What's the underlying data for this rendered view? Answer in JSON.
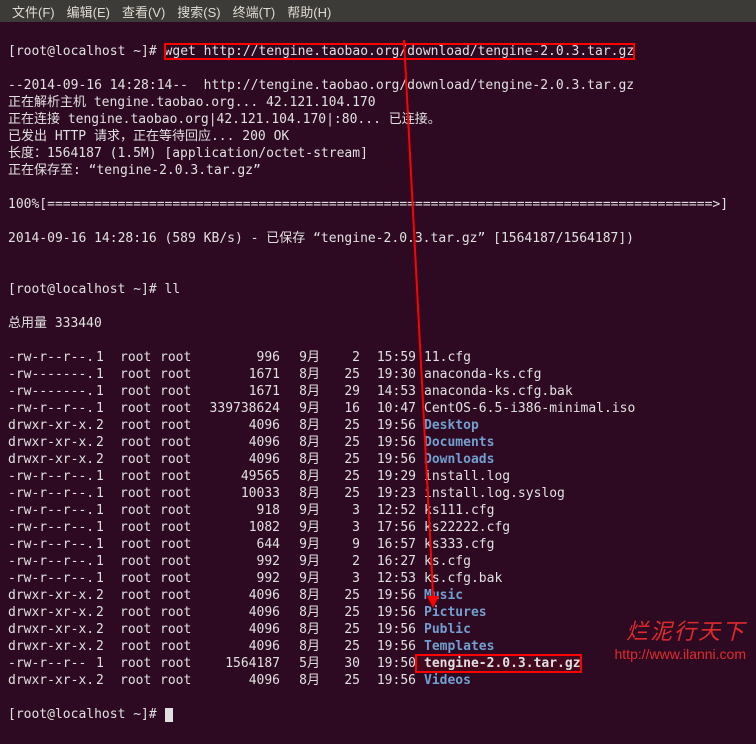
{
  "menubar": [
    "文件(F)",
    "编辑(E)",
    "查看(V)",
    "搜索(S)",
    "终端(T)",
    "帮助(H)"
  ],
  "prompt": "[root@localhost ~]#",
  "cmd_wget": "wget http://tengine.taobao.org/download/tengine-2.0.3.tar.gz",
  "wget_output": [
    "--2014-09-16 14:28:14--  http://tengine.taobao.org/download/tengine-2.0.3.tar.gz",
    "正在解析主机 tengine.taobao.org... 42.121.104.170",
    "正在连接 tengine.taobao.org|42.121.104.170|:80... 已连接。",
    "已发出 HTTP 请求，正在等待回应... 200 OK",
    "长度：1564187 (1.5M) [application/octet-stream]",
    "正在保存至: “tengine-2.0.3.tar.gz”",
    "",
    "100%[=====================================================================================>]",
    "",
    "2014-09-16 14:28:16 (589 KB/s) - 已保存 “tengine-2.0.3.tar.gz” [1564187/1564187])",
    ""
  ],
  "cmd_ll": "ll",
  "ll_total": "总用量 333440",
  "files": [
    {
      "perm": "-rw-r--r--.",
      "ln": "1",
      "own": "root",
      "grp": "root",
      "size": "996",
      "mon": "9月",
      "day": "2",
      "time": "15:59",
      "name": "11.cfg",
      "dir": false
    },
    {
      "perm": "-rw-------.",
      "ln": "1",
      "own": "root",
      "grp": "root",
      "size": "1671",
      "mon": "8月",
      "day": "25",
      "time": "19:30",
      "name": "anaconda-ks.cfg",
      "dir": false
    },
    {
      "perm": "-rw-------.",
      "ln": "1",
      "own": "root",
      "grp": "root",
      "size": "1671",
      "mon": "8月",
      "day": "29",
      "time": "14:53",
      "name": "anaconda-ks.cfg.bak",
      "dir": false
    },
    {
      "perm": "-rw-r--r--.",
      "ln": "1",
      "own": "root",
      "grp": "root",
      "size": "339738624",
      "mon": "9月",
      "day": "16",
      "time": "10:47",
      "name": "CentOS-6.5-i386-minimal.iso",
      "dir": false
    },
    {
      "perm": "drwxr-xr-x.",
      "ln": "2",
      "own": "root",
      "grp": "root",
      "size": "4096",
      "mon": "8月",
      "day": "25",
      "time": "19:56",
      "name": "Desktop",
      "dir": true
    },
    {
      "perm": "drwxr-xr-x.",
      "ln": "2",
      "own": "root",
      "grp": "root",
      "size": "4096",
      "mon": "8月",
      "day": "25",
      "time": "19:56",
      "name": "Documents",
      "dir": true
    },
    {
      "perm": "drwxr-xr-x.",
      "ln": "2",
      "own": "root",
      "grp": "root",
      "size": "4096",
      "mon": "8月",
      "day": "25",
      "time": "19:56",
      "name": "Downloads",
      "dir": true
    },
    {
      "perm": "-rw-r--r--.",
      "ln": "1",
      "own": "root",
      "grp": "root",
      "size": "49565",
      "mon": "8月",
      "day": "25",
      "time": "19:29",
      "name": "install.log",
      "dir": false
    },
    {
      "perm": "-rw-r--r--.",
      "ln": "1",
      "own": "root",
      "grp": "root",
      "size": "10033",
      "mon": "8月",
      "day": "25",
      "time": "19:23",
      "name": "install.log.syslog",
      "dir": false
    },
    {
      "perm": "-rw-r--r--.",
      "ln": "1",
      "own": "root",
      "grp": "root",
      "size": "918",
      "mon": "9月",
      "day": "3",
      "time": "12:52",
      "name": "ks111.cfg",
      "dir": false
    },
    {
      "perm": "-rw-r--r--.",
      "ln": "1",
      "own": "root",
      "grp": "root",
      "size": "1082",
      "mon": "9月",
      "day": "3",
      "time": "17:56",
      "name": "ks22222.cfg",
      "dir": false
    },
    {
      "perm": "-rw-r--r--.",
      "ln": "1",
      "own": "root",
      "grp": "root",
      "size": "644",
      "mon": "9月",
      "day": "9",
      "time": "16:57",
      "name": "ks333.cfg",
      "dir": false
    },
    {
      "perm": "-rw-r--r--.",
      "ln": "1",
      "own": "root",
      "grp": "root",
      "size": "992",
      "mon": "9月",
      "day": "2",
      "time": "16:27",
      "name": "ks.cfg",
      "dir": false
    },
    {
      "perm": "-rw-r--r--.",
      "ln": "1",
      "own": "root",
      "grp": "root",
      "size": "992",
      "mon": "9月",
      "day": "3",
      "time": "12:53",
      "name": "ks.cfg.bak",
      "dir": false
    },
    {
      "perm": "drwxr-xr-x.",
      "ln": "2",
      "own": "root",
      "grp": "root",
      "size": "4096",
      "mon": "8月",
      "day": "25",
      "time": "19:56",
      "name": "Music",
      "dir": true
    },
    {
      "perm": "drwxr-xr-x.",
      "ln": "2",
      "own": "root",
      "grp": "root",
      "size": "4096",
      "mon": "8月",
      "day": "25",
      "time": "19:56",
      "name": "Pictures",
      "dir": true
    },
    {
      "perm": "drwxr-xr-x.",
      "ln": "2",
      "own": "root",
      "grp": "root",
      "size": "4096",
      "mon": "8月",
      "day": "25",
      "time": "19:56",
      "name": "Public",
      "dir": true
    },
    {
      "perm": "drwxr-xr-x.",
      "ln": "2",
      "own": "root",
      "grp": "root",
      "size": "4096",
      "mon": "8月",
      "day": "25",
      "time": "19:56",
      "name": "Templates",
      "dir": true
    },
    {
      "perm": "-rw-r--r--",
      "ln": "1",
      "own": "root",
      "grp": "root",
      "size": "1564187",
      "mon": "5月",
      "day": "30",
      "time": "19:50",
      "name": "tengine-2.0.3.tar.gz",
      "dir": false,
      "hl": true
    },
    {
      "perm": "drwxr-xr-x.",
      "ln": "2",
      "own": "root",
      "grp": "root",
      "size": "4096",
      "mon": "8月",
      "day": "25",
      "time": "19:56",
      "name": "Videos",
      "dir": true
    }
  ],
  "watermark": {
    "cn": "烂泥行天下",
    "url": "http://www.ilanni.com"
  }
}
